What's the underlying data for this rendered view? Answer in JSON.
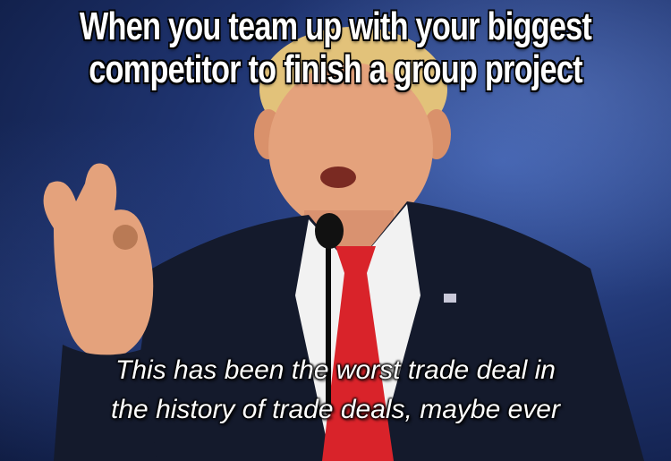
{
  "caption": {
    "line1": "When you team up with your biggest",
    "line2": "competitor to finish a group project"
  },
  "subtitle": {
    "line1": "This has been the worst trade deal in",
    "line2": "the history of trade deals, maybe ever"
  },
  "colors": {
    "background": "#1f3470",
    "suit": "#141a2c",
    "tie": "#d9232a",
    "shirt": "#f2f2f2",
    "skin": "#e4a27c",
    "hair": "#e2c27a"
  }
}
